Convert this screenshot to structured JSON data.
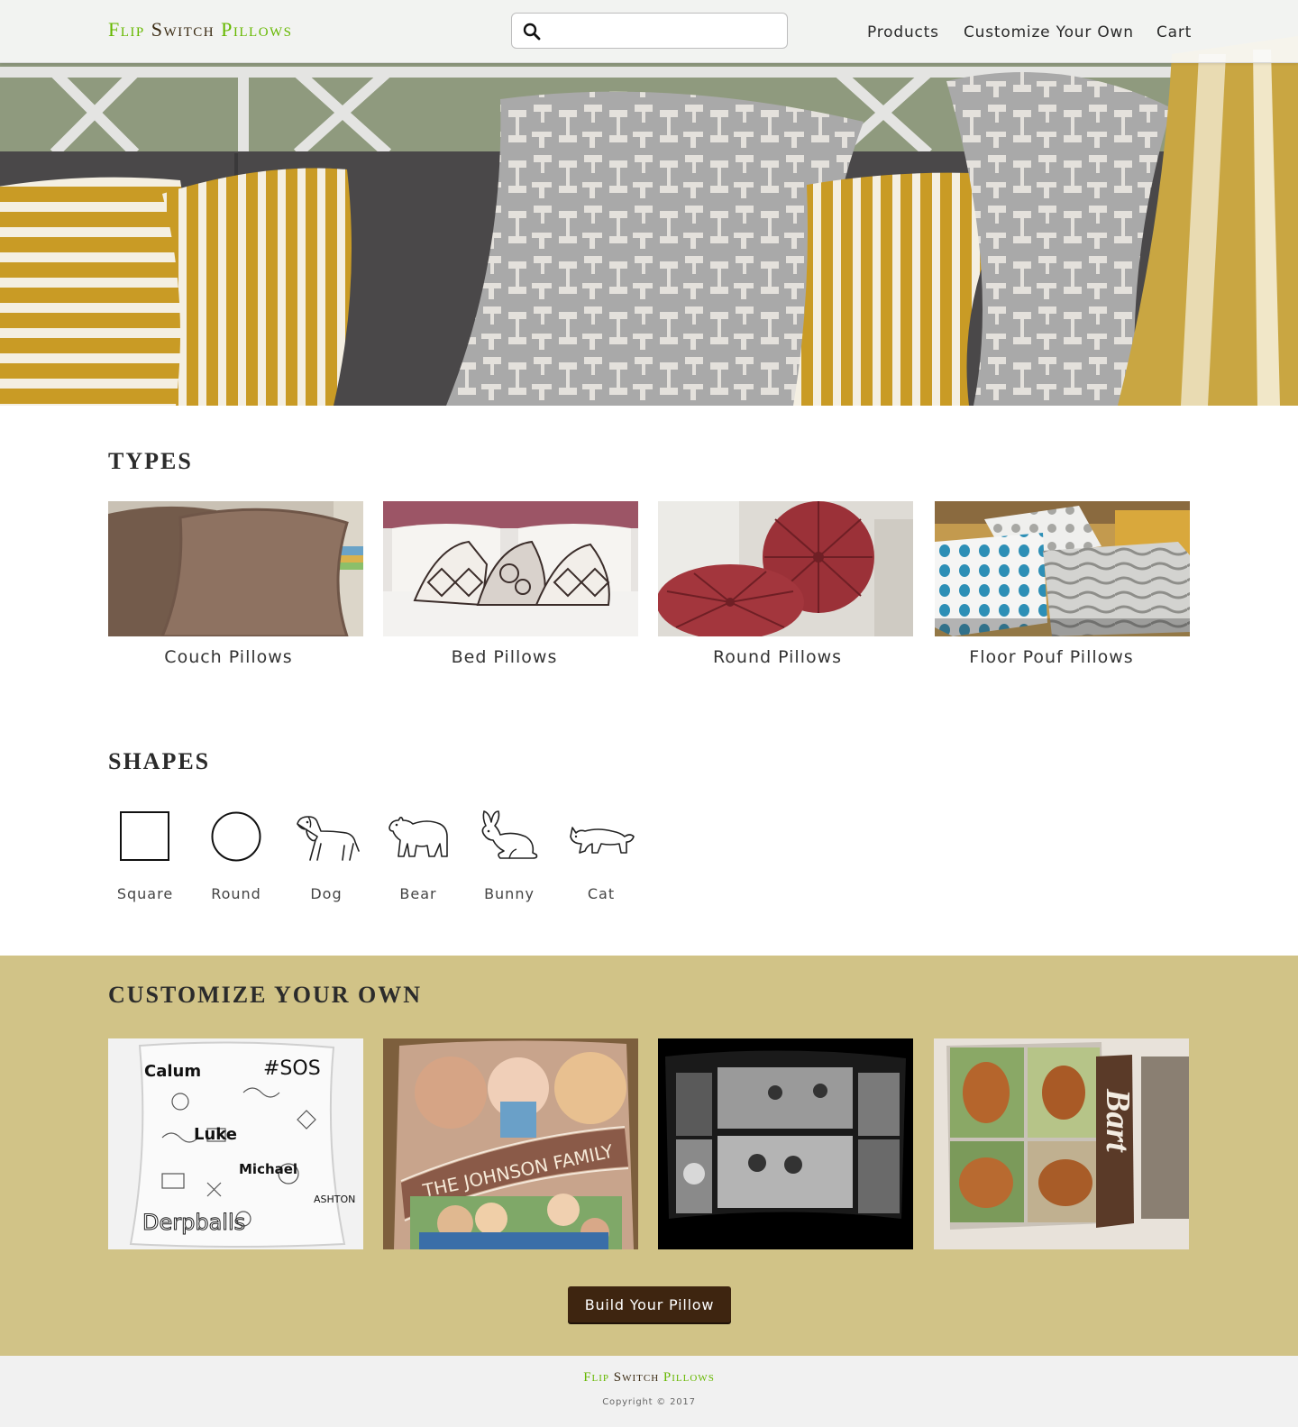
{
  "brand": {
    "word1": "Flip",
    "word2": "Switch",
    "word3": "Pillows"
  },
  "search": {
    "placeholder": "",
    "value": ""
  },
  "nav": {
    "products": "Products",
    "customize": "Customize Your Own",
    "cart": "Cart"
  },
  "types": {
    "title": "TYPES",
    "items": [
      {
        "label": "Couch Pillows"
      },
      {
        "label": "Bed Pillows"
      },
      {
        "label": "Round Pillows"
      },
      {
        "label": "Floor Pouf Pillows"
      }
    ]
  },
  "shapes": {
    "title": "SHAPES",
    "items": [
      {
        "label": "Square",
        "icon": "square-icon"
      },
      {
        "label": "Round",
        "icon": "circle-icon"
      },
      {
        "label": "Dog",
        "icon": "dog-icon"
      },
      {
        "label": "Bear",
        "icon": "bear-icon"
      },
      {
        "label": "Bunny",
        "icon": "bunny-icon"
      },
      {
        "label": "Cat",
        "icon": "cat-icon"
      }
    ]
  },
  "customize": {
    "title": "CUSTOMIZE YOUR OWN",
    "button": "Build Your Pillow",
    "cards": {
      "doodle_names": [
        "Calum",
        "#SOS",
        "Luke",
        "Michael",
        "ASHTON",
        "Derpballs"
      ],
      "family_banner": "THE JOHNSON FAMILY",
      "dog_name": "Bart"
    }
  },
  "footer": {
    "copyright": "Copyright © 2017"
  },
  "colors": {
    "brand_green": "#66b800",
    "brand_brown": "#3a2a12",
    "customize_bg": "#d1c387",
    "button_bg": "#3e2510",
    "footer_bg": "#f1f1f1"
  }
}
